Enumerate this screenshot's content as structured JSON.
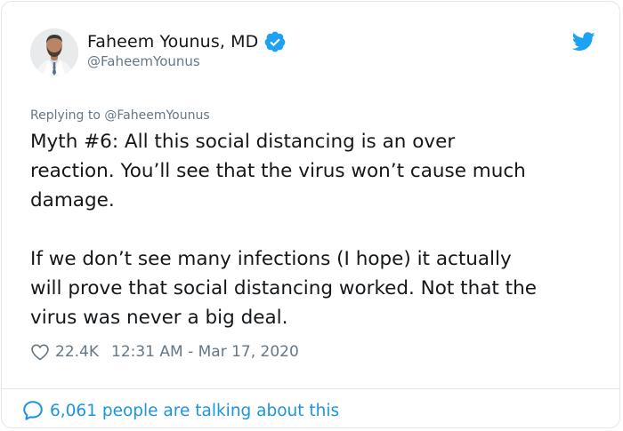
{
  "author": {
    "name": "Faheem Younus, MD",
    "handle": "@FaheemYounus",
    "verified": true,
    "avatar": "doctor-portrait"
  },
  "reply_context": "Replying to @FaheemYounus",
  "tweet": {
    "paragraphs": [
      "Myth #6: All this social distancing is an over\nreaction. You’ll see that the virus won’t cause much\ndamage.",
      "If we don’t see many infections (I hope) it actually\nwill prove that social distancing worked. Not that the\nvirus was never a big deal."
    ]
  },
  "stats": {
    "likes": "22.4K",
    "timestamp": "12:31 AM - Mar 17, 2020"
  },
  "footer": {
    "talking": "6,061 people are talking about this"
  },
  "icons": {
    "platform": "twitter-bird-icon",
    "verified": "verified-badge-icon",
    "like": "heart-icon",
    "conversation": "speech-bubble-icon"
  },
  "colors": {
    "brand": "#1da1f2",
    "link": "#1b95e0",
    "muted": "#657786",
    "text": "#14171a",
    "border": "#e1e8ed"
  }
}
